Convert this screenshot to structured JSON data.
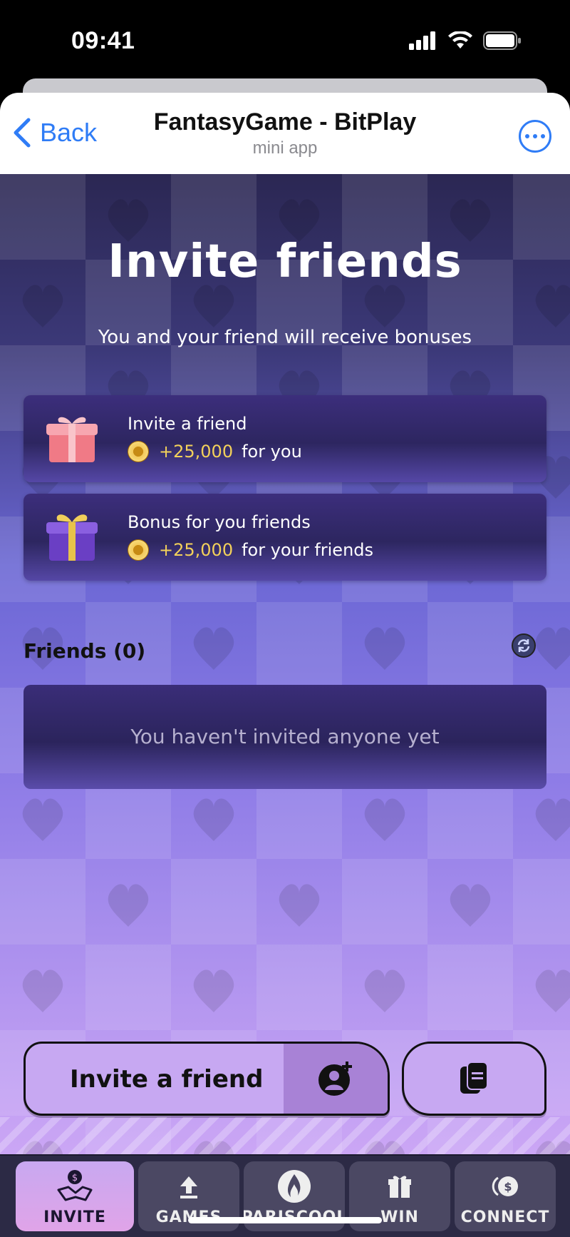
{
  "status_bar": {
    "time": "09:41"
  },
  "header": {
    "back_label": "Back",
    "title": "FantasyGame - BitPlay",
    "subtitle": "mini app"
  },
  "main": {
    "title": "Invite friends",
    "subtitle": "You and your friend will receive bonuses",
    "bonus_cards": [
      {
        "title": "Invite a friend",
        "amount": "+25,000",
        "suffix": "for you",
        "icon": "pink-gift-icon"
      },
      {
        "title": "Bonus for you friends",
        "amount": "+25,000",
        "suffix": "for your friends",
        "icon": "purple-gift-icon"
      }
    ],
    "friends_label": "Friends (0)",
    "empty_message": "You haven't invited anyone yet"
  },
  "actions": {
    "invite_label": "Invite a friend",
    "invite_icon": "add-user-icon",
    "copy_icon": "copy-icon"
  },
  "nav": {
    "items": [
      {
        "label": "INVITE",
        "icon": "handshake-icon",
        "active": true
      },
      {
        "label": "GAMES",
        "icon": "upload-icon",
        "active": false
      },
      {
        "label": "PARISCOOL",
        "icon": "flame-icon",
        "active": false
      },
      {
        "label": "WIN",
        "icon": "gift-icon",
        "active": false
      },
      {
        "label": "CONNECT",
        "icon": "coin-icon",
        "active": false
      }
    ]
  },
  "colors": {
    "accent_blue": "#2f7cf6",
    "reward_gold": "#f3d15a",
    "button_lilac": "#c7a8f2"
  }
}
